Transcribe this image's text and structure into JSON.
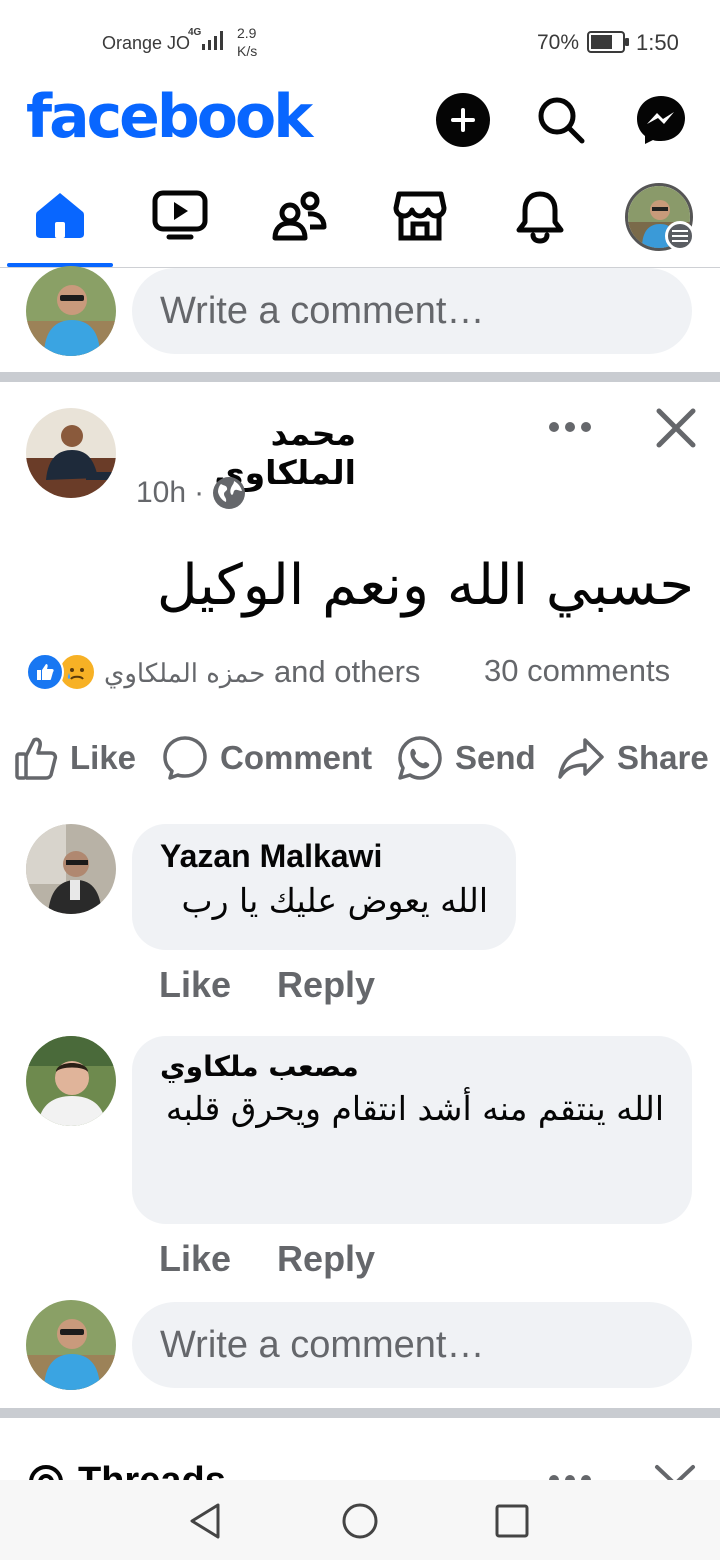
{
  "status_bar": {
    "carrier": "Orange JO",
    "network": "4G",
    "speed_value": "2.9",
    "speed_unit": "K/s",
    "battery": "70%",
    "battery_level": 0.7,
    "time": "1:50"
  },
  "header": {
    "logo": "facebook",
    "brand_color": "#0866ff",
    "actions": [
      "add-icon",
      "search-icon",
      "messenger-icon"
    ]
  },
  "tabs": [
    {
      "name": "home",
      "icon": "home-icon",
      "active": true
    },
    {
      "name": "video",
      "icon": "video-icon",
      "active": false
    },
    {
      "name": "friends",
      "icon": "friends-icon",
      "active": false
    },
    {
      "name": "marketplace",
      "icon": "marketplace-icon",
      "active": false
    },
    {
      "name": "notifications",
      "icon": "bell-icon",
      "active": false
    },
    {
      "name": "menu",
      "icon": "profile-menu-icon",
      "active": false
    }
  ],
  "top_comment_input": {
    "placeholder": "Write a comment…"
  },
  "post": {
    "author": "محمد الملكاوي",
    "time": "10h",
    "audience_icon": "globe-icon",
    "text": "حسبي الله ونعم الوكيل",
    "reactions_names": "حمزه الملكاوي",
    "reactions_suffix": "and others",
    "comments_count": "30 comments",
    "actions": {
      "like": "Like",
      "comment": "Comment",
      "send": "Send",
      "share": "Share"
    }
  },
  "comments": [
    {
      "name": "Yazan Malkawi",
      "text": "الله يعوض عليك يا رب",
      "like": "Like",
      "reply": "Reply"
    },
    {
      "name": "مصعب ملكاوي",
      "text": "الله ينتقم منه أشد انتقام ويحرق قلبه",
      "like": "Like",
      "reply": "Reply"
    }
  ],
  "bottom_comment_input": {
    "placeholder": "Write a comment…"
  },
  "next_post": {
    "title": "Threads"
  },
  "nav": [
    "back-icon",
    "home-circle-icon",
    "recents-icon"
  ]
}
